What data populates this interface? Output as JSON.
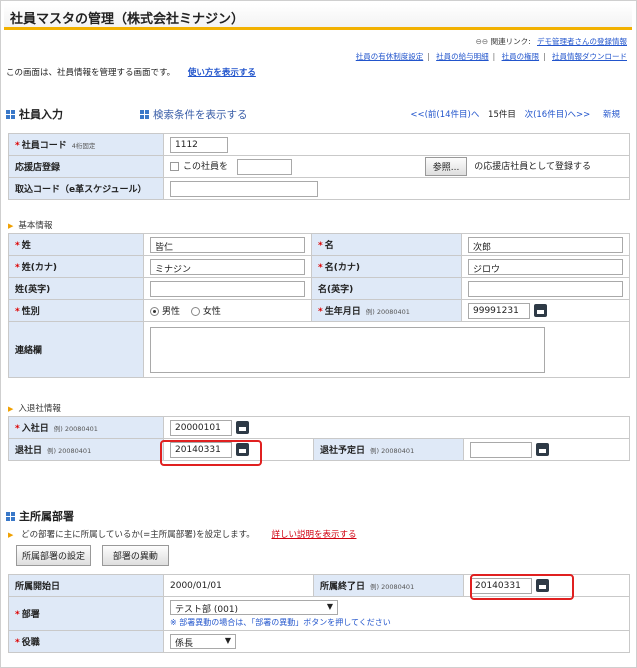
{
  "title": "社員マスタの管理（株式会社ミナジン）",
  "top": {
    "related_label": "関連リンク:",
    "related_link": "デモ管理者さんの登録情報",
    "links": [
      "社員の有休制度設定",
      "社員の給与明細",
      "社員の権限",
      "社員情報ダウンロード"
    ],
    "description": "この画面は、社員情報を管理する画面です。",
    "howto": "使い方を表示する"
  },
  "section": {
    "title": "社員入力",
    "search_toggle": "検索条件を表示する",
    "prev": "<<(前(14件目)へ",
    "current": "15件目",
    "next": "次(16件目)へ>>",
    "new": "新規"
  },
  "employee_code": {
    "label": "社員コード",
    "hint": "4桁固定",
    "value": "1112"
  },
  "agency": {
    "label": "応援店登録",
    "checkbox": "この社員を",
    "browse": "参照...",
    "suffix": "の応援店社員として登録する"
  },
  "trade_code": {
    "label": "取込コード（e革スケジュール）"
  },
  "basic": {
    "header": "基本情報",
    "last_name": {
      "label": "姓",
      "value": "皆仁"
    },
    "first_name": {
      "label": "名",
      "value": "次郎"
    },
    "last_kana": {
      "label": "姓(カナ)",
      "value": "ミナジン"
    },
    "first_kana": {
      "label": "名(カナ)",
      "value": "ジロウ"
    },
    "last_en": {
      "label": "姓(英字)"
    },
    "first_en": {
      "label": "名(英字)"
    },
    "gender": {
      "label": "性別",
      "male": "男性",
      "female": "女性",
      "selected": "男性"
    },
    "birth": {
      "label": "生年月日",
      "hint": "例) 20080401",
      "value": "99991231"
    },
    "contact": {
      "label": "連絡欄"
    }
  },
  "entry": {
    "header": "入退社情報",
    "join": {
      "label": "入社日",
      "hint": "例) 20080401",
      "value": "20000101"
    },
    "leave": {
      "label": "退社日",
      "hint": "例) 20080401",
      "value": "20140331"
    },
    "leave_plan": {
      "label": "退社予定日",
      "hint": "例) 20080401"
    }
  },
  "dept": {
    "title": "主所属部署",
    "desc": "どの部署に主に所属しているか(=主所属部署)を設定します。",
    "detail_link": "詳しい説明を表示する",
    "btn_setting": "所属部署の設定",
    "btn_transfer": "部署の異動",
    "start": {
      "label": "所属開始日",
      "value": "2000/01/01"
    },
    "end": {
      "label": "所属終了日",
      "hint": "例) 20080401",
      "value": "20140331"
    },
    "department": {
      "label": "部署",
      "value": "テスト部 (001)",
      "note": "※ 部署異動の場合は、「部署の異動」ボタンを押してください"
    },
    "position": {
      "label": "役職",
      "value": "係長"
    }
  }
}
